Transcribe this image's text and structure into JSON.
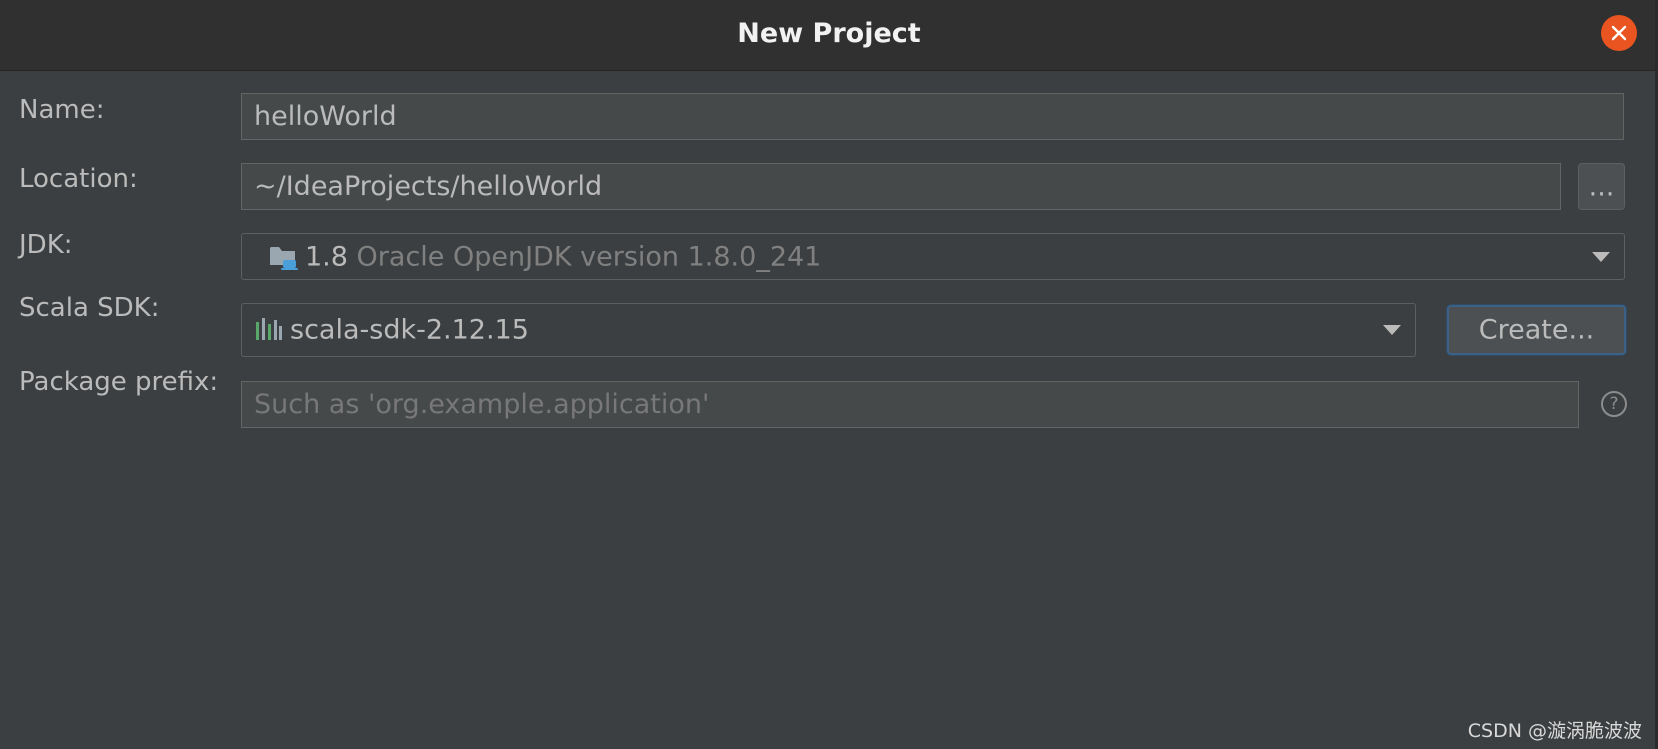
{
  "window": {
    "title": "New Project"
  },
  "form": {
    "name": {
      "label": "Name:",
      "value": "helloWorld"
    },
    "location": {
      "label": "Location:",
      "value": "~/IdeaProjects/helloWorld",
      "browse_label": "..."
    },
    "jdk": {
      "label": "JDK:",
      "version": "1.8",
      "description": "Oracle OpenJDK version 1.8.0_241",
      "icon": "folder-jdk-icon"
    },
    "scala_sdk": {
      "label": "Scala SDK:",
      "value": "scala-sdk-2.12.15",
      "icon": "scala-library-icon",
      "create_label": "Create..."
    },
    "package_prefix": {
      "label": "Package prefix:",
      "value": "",
      "placeholder": "Such as 'org.example.application'",
      "help_icon": "help-icon",
      "help_glyph": "?"
    }
  },
  "watermark": "CSDN @漩涡脆波波",
  "colors": {
    "close_button": "#e95420",
    "focus_ring": "#3d6185"
  }
}
